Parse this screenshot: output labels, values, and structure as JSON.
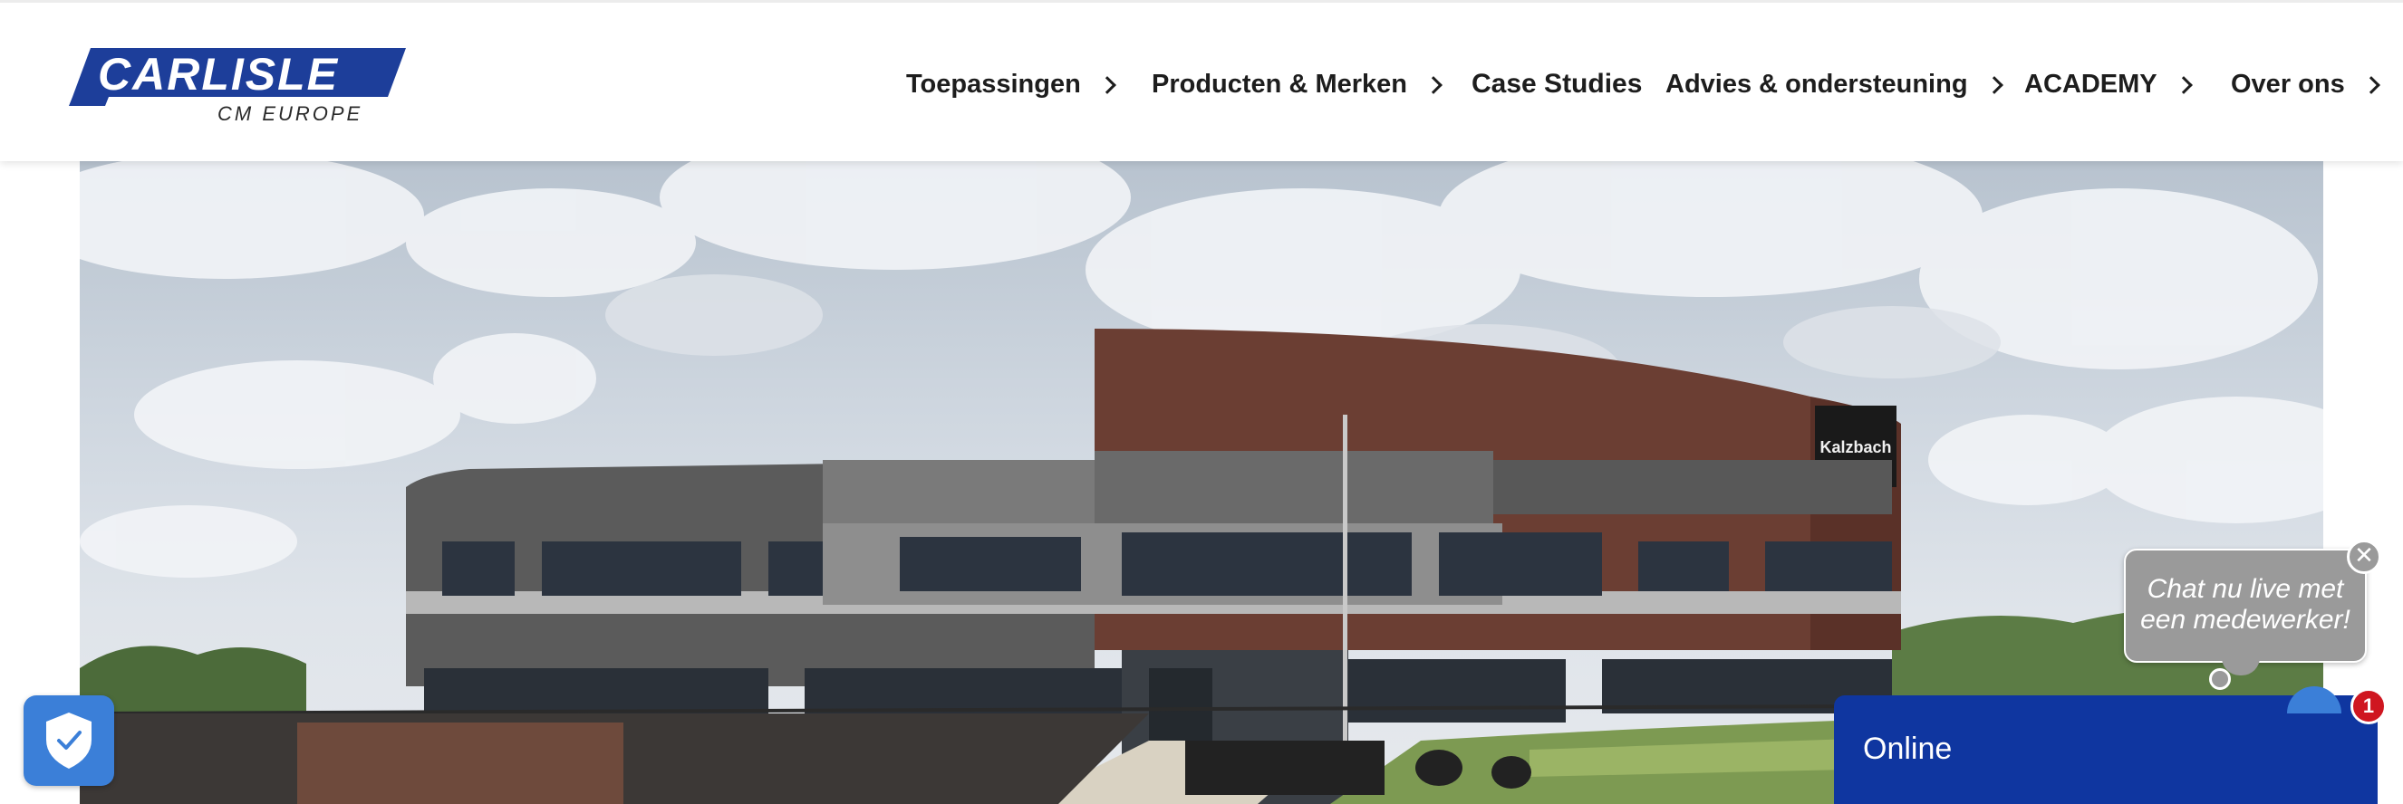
{
  "brand": {
    "logo_text": "CARLISLE",
    "logo_subtitle": "CM EUROPE",
    "color": "#1d3e9a"
  },
  "nav": {
    "items": [
      {
        "label": "Toepassingen",
        "has_chevron": true
      },
      {
        "label": "Producten & Merken",
        "has_chevron": true
      },
      {
        "label": "Case Studies",
        "has_chevron": false
      },
      {
        "label": "Advies & ondersteuning",
        "has_chevron": true
      },
      {
        "label": "ACADEMY",
        "has_chevron": true
      },
      {
        "label": "Over ons",
        "has_chevron": true
      }
    ]
  },
  "hero": {
    "building_sign": "Kalzbach"
  },
  "privacy": {
    "icon": "shield-check-icon",
    "color": "#3b7fd8"
  },
  "chat": {
    "bubble_text": "Chat nu live met een medewerker!",
    "status_label": "Online",
    "unread_count": "1",
    "close_symbol": "✕",
    "panel_color": "#0f36a0",
    "badge_color": "#cf1620"
  }
}
